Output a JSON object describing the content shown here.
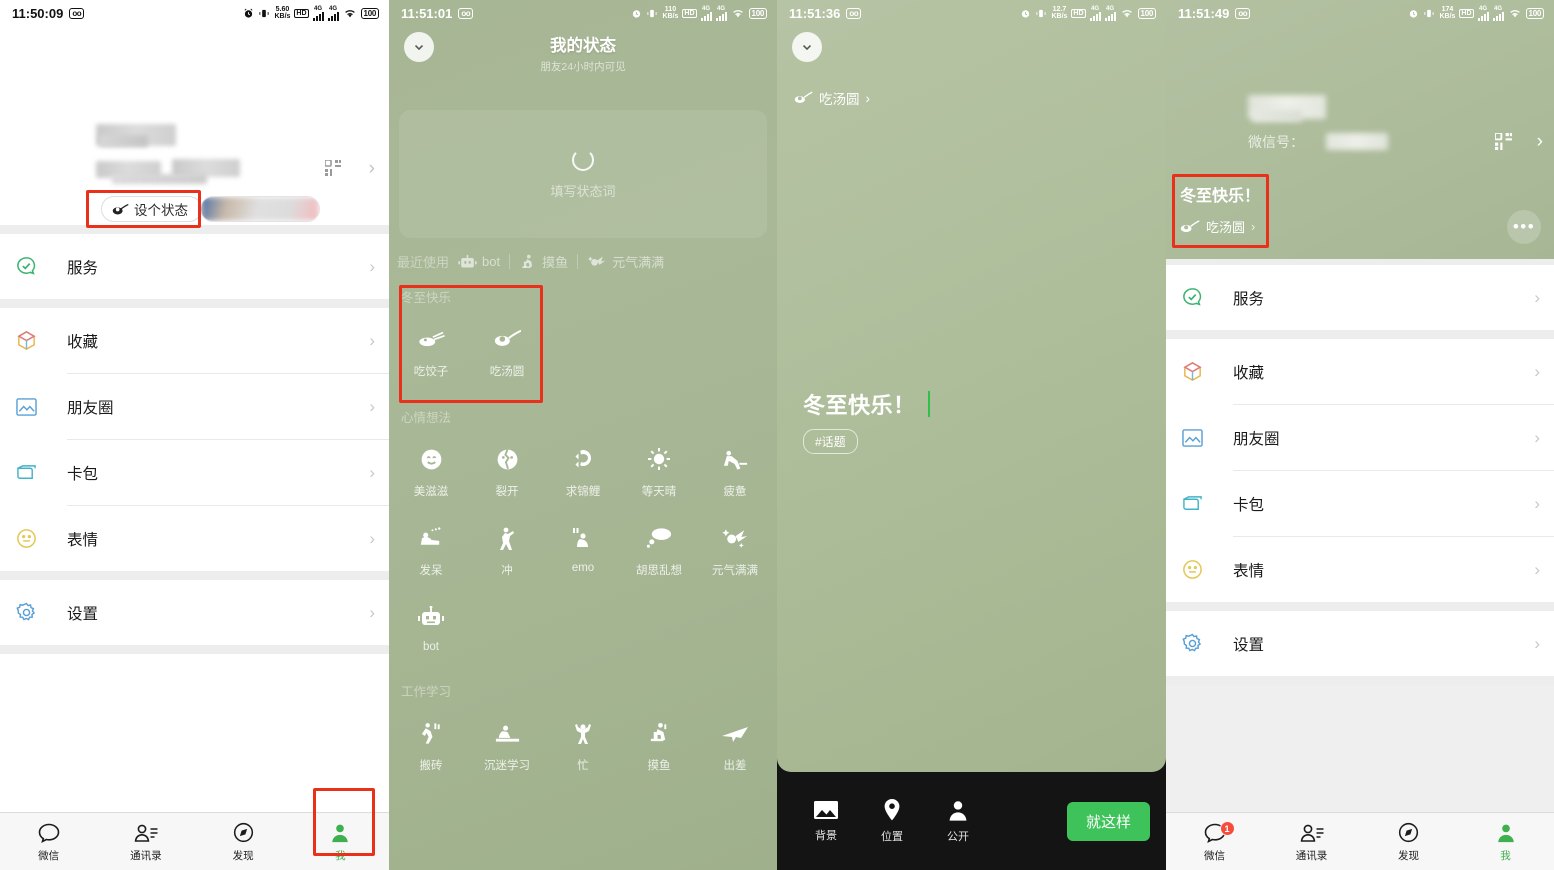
{
  "panel1": {
    "statusbar": {
      "time": "11:50:09",
      "wo": "⑩",
      "net_speed": "5.60",
      "net_unit": "KB/s",
      "hd": "HD",
      "hd_sub": "2",
      "sig1": "4G",
      "sig2": "4G",
      "battery": "100"
    },
    "profile": {
      "status_button": "设个状态",
      "chevron": "›"
    },
    "menu": [
      {
        "group": [
          {
            "label": "服务",
            "icon": "service-icon"
          }
        ]
      },
      {
        "group": [
          {
            "label": "收藏",
            "icon": "favorites-icon"
          },
          {
            "label": "朋友圈",
            "icon": "moments-icon"
          },
          {
            "label": "卡包",
            "icon": "cards-icon"
          },
          {
            "label": "表情",
            "icon": "sticker-icon"
          }
        ]
      },
      {
        "group": [
          {
            "label": "设置",
            "icon": "settings-icon"
          }
        ]
      }
    ],
    "tabs": [
      {
        "label": "微信",
        "icon": "chat-icon",
        "active": false,
        "badge": ""
      },
      {
        "label": "通讯录",
        "icon": "contacts-icon",
        "active": false,
        "badge": ""
      },
      {
        "label": "发现",
        "icon": "discover-icon",
        "active": false,
        "badge": ""
      },
      {
        "label": "我",
        "icon": "me-icon",
        "active": true,
        "badge": ""
      }
    ]
  },
  "panel2": {
    "statusbar": {
      "time": "11:51:01",
      "net_speed": "110",
      "net_unit": "KB/s",
      "hd": "HD",
      "hd_sub": "2",
      "sig1": "4G",
      "sig2": "4G",
      "battery": "100"
    },
    "title": "我的状态",
    "subtitle": "朋友24小时内可见",
    "input_placeholder": "填写状态词",
    "recent_label": "最近使用",
    "recent_items": [
      {
        "label": "bot",
        "icon": "robot-icon"
      },
      {
        "label": "摸鱼",
        "icon": "slacking-icon"
      },
      {
        "label": "元气满满",
        "icon": "energetic-icon"
      }
    ],
    "sections": [
      {
        "title": "冬至快乐",
        "highlighted": true,
        "items": [
          {
            "label": "吃饺子",
            "icon": "dumpling-icon"
          },
          {
            "label": "吃汤圆",
            "icon": "tangyuan-icon"
          }
        ]
      },
      {
        "title": "心情想法",
        "highlighted": false,
        "items": [
          {
            "label": "美滋滋",
            "icon": "happy-face-icon"
          },
          {
            "label": "裂开",
            "icon": "cracked-icon"
          },
          {
            "label": "求锦鲤",
            "icon": "koi-icon"
          },
          {
            "label": "等天晴",
            "icon": "sun-icon"
          },
          {
            "label": "疲惫",
            "icon": "tired-icon"
          },
          {
            "label": "发呆",
            "icon": "daze-icon"
          },
          {
            "label": "冲",
            "icon": "charge-icon"
          },
          {
            "label": "emo",
            "icon": "emo-icon"
          },
          {
            "label": "胡思乱想",
            "icon": "thought-cloud-icon"
          },
          {
            "label": "元气满满",
            "icon": "energetic-icon"
          },
          {
            "label": "bot",
            "icon": "robot-icon"
          }
        ]
      },
      {
        "title": "工作学习",
        "highlighted": false,
        "items": [
          {
            "label": "搬砖",
            "icon": "bricks-icon"
          },
          {
            "label": "沉迷学习",
            "icon": "study-icon"
          },
          {
            "label": "忙",
            "icon": "busy-icon"
          },
          {
            "label": "摸鱼",
            "icon": "slacking-icon"
          },
          {
            "label": "出差",
            "icon": "plane-icon"
          }
        ]
      }
    ]
  },
  "panel3": {
    "statusbar": {
      "time": "11:51:36",
      "net_speed": "12.7",
      "net_unit": "KB/s",
      "hd": "HD",
      "hd_sub": "2",
      "sig1": "4G",
      "sig2": "4G",
      "battery": "100"
    },
    "tag_label": "吃汤圆",
    "tag_chevron": "›",
    "status_text": "冬至快乐！",
    "topic_chip": "#话题",
    "toolbar": [
      {
        "label": "背景",
        "icon": "image-icon"
      },
      {
        "label": "位置",
        "icon": "location-pin-icon"
      },
      {
        "label": "公开",
        "icon": "person-icon"
      }
    ],
    "confirm_button": "就这样",
    "accent_color": "#3ec35a"
  },
  "panel4": {
    "statusbar": {
      "time": "11:51:49",
      "net_speed": "174",
      "net_unit": "KB/s",
      "hd": "HD",
      "hd_sub": "2",
      "sig1": "4G",
      "sig2": "4G",
      "battery": "100"
    },
    "wxid_label": "微信号：",
    "status_line1": "冬至快乐！",
    "status_line2": "吃汤圆",
    "status_chevron": "›",
    "more_dots": "•••",
    "chevron": "›",
    "menu": [
      {
        "group": [
          {
            "label": "服务",
            "icon": "service-icon"
          }
        ]
      },
      {
        "group": [
          {
            "label": "收藏",
            "icon": "favorites-icon"
          },
          {
            "label": "朋友圈",
            "icon": "moments-icon"
          },
          {
            "label": "卡包",
            "icon": "cards-icon"
          },
          {
            "label": "表情",
            "icon": "sticker-icon"
          }
        ]
      },
      {
        "group": [
          {
            "label": "设置",
            "icon": "settings-icon"
          }
        ]
      }
    ],
    "tabs": [
      {
        "label": "微信",
        "icon": "chat-icon",
        "active": false,
        "badge": "1"
      },
      {
        "label": "通讯录",
        "icon": "contacts-icon",
        "active": false,
        "badge": ""
      },
      {
        "label": "发现",
        "icon": "discover-icon",
        "active": false,
        "badge": ""
      },
      {
        "label": "我",
        "icon": "me-icon",
        "active": true,
        "badge": ""
      }
    ]
  },
  "annotations": {
    "highlight_color": "#e8301a"
  }
}
